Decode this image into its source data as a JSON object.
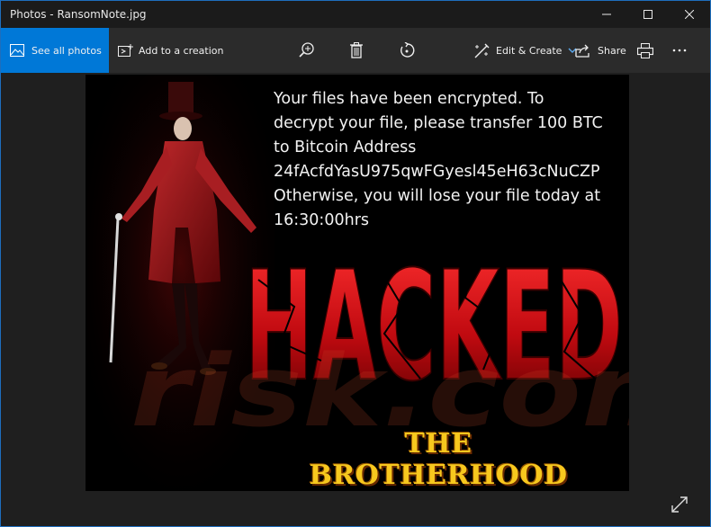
{
  "window": {
    "title": "Photos - RansomNote.jpg",
    "accent": "#0078d7"
  },
  "toolbar": {
    "see_all_label": "See all photos",
    "add_creation_label": "Add to a creation",
    "edit_create_label": "Edit & Create",
    "share_label": "Share",
    "icons": [
      "zoom-in-icon",
      "delete-icon",
      "rotate-icon",
      "print-icon",
      "more-icon"
    ]
  },
  "image": {
    "note_lines": [
      "Your files have been encrypted. To",
      "decrypt your file, please transfer 100 BTC",
      "to Bitcoin Address",
      "24fAcfdYasU975qwFGyesl45eH63cNuCZP",
      "Otherwise, you will lose your file today at",
      "16:30:00hrs"
    ],
    "headline": "HACKED",
    "group_name": "THE BROTHERHOOD"
  }
}
